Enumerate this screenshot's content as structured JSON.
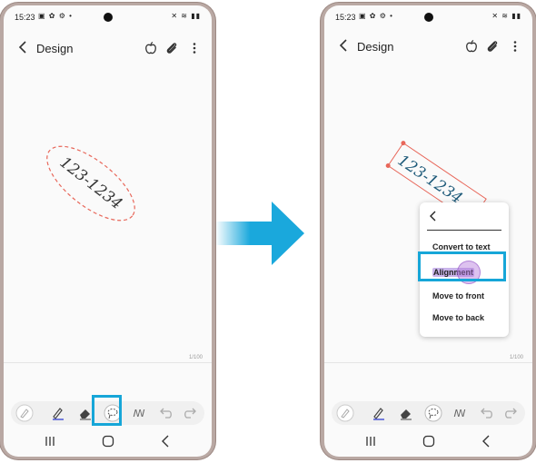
{
  "screens": [
    {
      "status_time": "15:23",
      "title": "Design",
      "handwriting": "123-1234",
      "page_count": "1/100"
    },
    {
      "status_time": "15:23",
      "title": "Design",
      "handwriting": "123-1234",
      "page_count": "1/100",
      "context_menu": {
        "items": [
          "Convert to text",
          "Alignment",
          "Move to front",
          "Move to back"
        ],
        "highlighted": "Alignment"
      }
    }
  ],
  "colors": {
    "highlight_box": "#16a6d8",
    "arrow": "#1aa8dc",
    "lasso": "#e8675a",
    "phone_frame": "#b9a8a3"
  },
  "icons": {
    "app_bar": [
      "back-icon",
      "apple-ink-icon",
      "paperclip-icon",
      "more-vert-icon"
    ],
    "toolbar": [
      "pen-disabled-icon",
      "pen-icon",
      "eraser-icon",
      "lasso-select-icon",
      "insert-icon",
      "undo-icon",
      "redo-icon"
    ],
    "navbar": [
      "recents-icon",
      "home-icon",
      "back-nav-icon"
    ]
  }
}
